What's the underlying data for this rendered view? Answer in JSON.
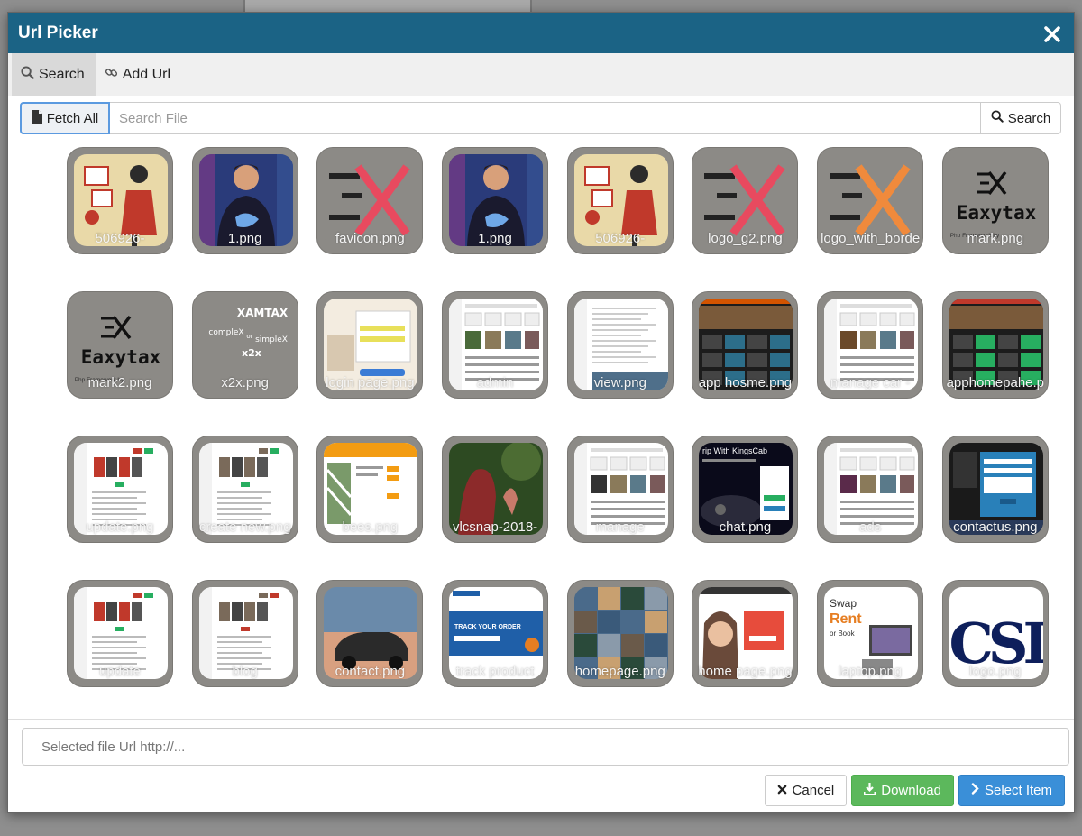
{
  "dialog": {
    "title": "Url Picker"
  },
  "tabs": [
    {
      "label": "Search",
      "icon": "search-icon",
      "active": true
    },
    {
      "label": "Add Url",
      "icon": "link-icon",
      "active": false
    }
  ],
  "search": {
    "fetch_all_label": "Fetch All",
    "placeholder": "Search File",
    "button_label": "Search"
  },
  "files": [
    {
      "name": "506926-",
      "thumb": "illustration",
      "colors": [
        "#e9d9a8",
        "#c0392b",
        "#2b2b2b"
      ]
    },
    {
      "name": "1.png",
      "thumb": "person",
      "colors": [
        "#2a3b7a",
        "#6fa8e8",
        "#1a1a2e"
      ]
    },
    {
      "name": "favicon.png",
      "thumb": "logo-x",
      "colors": [
        "#8c8a86",
        "#e84a5f",
        "#222"
      ]
    },
    {
      "name": "1.png",
      "thumb": "person",
      "colors": [
        "#2a3b7a",
        "#6fa8e8",
        "#1a1a2e"
      ]
    },
    {
      "name": "506926-",
      "thumb": "illustration",
      "colors": [
        "#e9d9a8",
        "#c0392b",
        "#2b2b2b"
      ]
    },
    {
      "name": "logo_g2.png",
      "thumb": "logo-x",
      "colors": [
        "#8c8a86",
        "#e84a5f",
        "#222"
      ]
    },
    {
      "name": "logo_with_borde",
      "thumb": "logo-x",
      "colors": [
        "#8c8a86",
        "#f08a3c",
        "#222"
      ]
    },
    {
      "name": "mark.png",
      "thumb": "eaxytax",
      "colors": [
        "#8c8a86",
        "#111",
        "#333"
      ]
    },
    {
      "name": "mark2.png",
      "thumb": "eaxytax",
      "colors": [
        "#8c8a86",
        "#111",
        "#333"
      ]
    },
    {
      "name": "x2x.png",
      "thumb": "xamtax",
      "colors": [
        "#8c8a86",
        "#fff",
        "#ddd"
      ]
    },
    {
      "name": "login page.png",
      "thumb": "login",
      "colors": [
        "#f3ece0",
        "#e8e05a",
        "#3a7bd5"
      ]
    },
    {
      "name": "admin",
      "thumb": "dashboard",
      "colors": [
        "#ffffff",
        "#4a6a3a",
        "#999"
      ]
    },
    {
      "name": "view.png",
      "thumb": "document",
      "colors": [
        "#ffffff",
        "#cccccc",
        "#4f6f8a"
      ]
    },
    {
      "name": "app hosme.png",
      "thumb": "dark-grid",
      "colors": [
        "#1c1c1c",
        "#d35400",
        "#2c6e8a"
      ]
    },
    {
      "name": "manage car -",
      "thumb": "dashboard",
      "colors": [
        "#ffffff",
        "#6b4a2a",
        "#999"
      ]
    },
    {
      "name": "apphomepahe.p",
      "thumb": "dark-grid",
      "colors": [
        "#1c1c1c",
        "#c0392b",
        "#27ae60"
      ]
    },
    {
      "name": "update.png",
      "thumb": "webpage",
      "colors": [
        "#ffffff",
        "#c0392b",
        "#27ae60"
      ]
    },
    {
      "name": "create new.png",
      "thumb": "webpage",
      "colors": [
        "#ffffff",
        "#7a6a5a",
        "#27ae60"
      ]
    },
    {
      "name": "bees.png",
      "thumb": "shop",
      "colors": [
        "#ffffff",
        "#f39c12",
        "#7a9a6a"
      ]
    },
    {
      "name": "vlcsnap-2018-",
      "thumb": "photo",
      "colors": [
        "#2d4a22",
        "#8c2a2a",
        "#5a7a3a"
      ]
    },
    {
      "name": "manage",
      "thumb": "dashboard",
      "colors": [
        "#ffffff",
        "#333333",
        "#999"
      ]
    },
    {
      "name": "chat.png",
      "thumb": "car-dark",
      "colors": [
        "#0a0a1a",
        "#2980b9",
        "#27ae60"
      ]
    },
    {
      "name": "ads",
      "thumb": "dashboard",
      "colors": [
        "#ffffff",
        "#5a2a4a",
        "#999"
      ]
    },
    {
      "name": "contactus.png",
      "thumb": "dark-form",
      "colors": [
        "#1a1a1a",
        "#2980b9",
        "#ffffff"
      ]
    },
    {
      "name": "update",
      "thumb": "webpage",
      "colors": [
        "#ffffff",
        "#c0392b",
        "#27ae60"
      ]
    },
    {
      "name": "blog",
      "thumb": "webpage",
      "colors": [
        "#ffffff",
        "#7a6a5a",
        "#c0392b"
      ]
    },
    {
      "name": "contact.png",
      "thumb": "car-photo",
      "colors": [
        "#d8a080",
        "#2a2a2a",
        "#6a8aaa"
      ]
    },
    {
      "name": "track product",
      "thumb": "blue-banner",
      "colors": [
        "#ffffff",
        "#1f5fa8",
        "#e67e22"
      ]
    },
    {
      "name": "homepage.png",
      "thumb": "collage",
      "colors": [
        "#4a6a8a",
        "#c8a070",
        "#2a4a3a"
      ]
    },
    {
      "name": "home page.png",
      "thumb": "woman",
      "colors": [
        "#ffffff",
        "#e74c3c",
        "#6a4a3a"
      ]
    },
    {
      "name": "laptop.png",
      "thumb": "swap-rent",
      "colors": [
        "#ffffff",
        "#e67e22",
        "#333333"
      ]
    },
    {
      "name": "logo.png",
      "thumb": "csi-logo",
      "colors": [
        "#ffffff",
        "#0e1f5b",
        "#0e1f5b"
      ]
    }
  ],
  "tile_text": {
    "illustration": "",
    "eaxytax_word": "Eaxytax",
    "eaxytax_sub": "Php Framework by",
    "xamtax_top": "XAMTAX",
    "xamtax_a": "compleX",
    "xamtax_b": "simpleX",
    "xamtax_c": "x2x",
    "xamtax_or": "or",
    "chat_title": "rip With KingsCab",
    "track_title": "TRACK YOUR ORDER",
    "swap": "Swap",
    "rent": "Rent",
    "or_book": "or Book",
    "csi": "CSI"
  },
  "footer": {
    "url_placeholder": "Selected file Url http://...",
    "cancel_label": "Cancel",
    "download_label": "Download",
    "select_label": "Select Item"
  },
  "colors": {
    "header": "#1b6385",
    "download": "#5cb85c",
    "select": "#3a8fd8"
  }
}
